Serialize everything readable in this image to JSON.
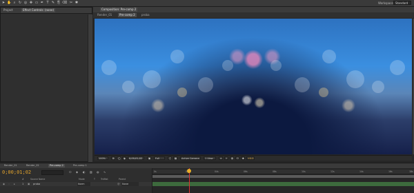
{
  "toolbar": {
    "tools": [
      "select-tool",
      "hand-tool",
      "zoom-tool",
      "rotate-tool",
      "camera-tool",
      "pan-tool",
      "mask-tool",
      "pen-tool",
      "text-tool",
      "brush-tool",
      "clone-tool",
      "eraser-tool",
      "roto-tool",
      "puppet-tool"
    ],
    "workspace_label": "Workspace:",
    "workspace_value": "Standard"
  },
  "left_panel": {
    "tabs": [
      "Project",
      "Effect Controls: (none)"
    ]
  },
  "composition_panel": {
    "tab_title": "Composition: Pre-comp 2",
    "breadcrumbs": [
      "Render_01",
      "Pre-comp 2",
      "proba"
    ],
    "active_breadcrumb": "Pre-comp 2"
  },
  "viewer_controls": {
    "zoom": "100%",
    "timecode": "0;00;01;02",
    "resolution": "Full",
    "camera": "Active Camera",
    "views": "1 View",
    "exposure": "+0.0"
  },
  "timeline": {
    "tabs": [
      "Render_01",
      "Render_02",
      "Pre-comp 2",
      "Pre-comp 1"
    ],
    "active_tab": "Pre-comp 2",
    "timecode": "0;00;01;02",
    "columns": [
      "#",
      "Source Name",
      "Mode",
      "T",
      "TrkMat",
      "Parent"
    ],
    "layer": {
      "number": "1",
      "name": "proba",
      "mode": "Norm",
      "parent": "None"
    },
    "ruler_ticks": [
      "0s",
      "02s",
      "04s",
      "06s",
      "08s",
      "10s",
      "12s",
      "14s",
      "16s",
      "18s"
    ],
    "playhead_fraction": 0.14
  },
  "colors": {
    "timecode": "#e3a42d",
    "playhead": "#e03131"
  }
}
